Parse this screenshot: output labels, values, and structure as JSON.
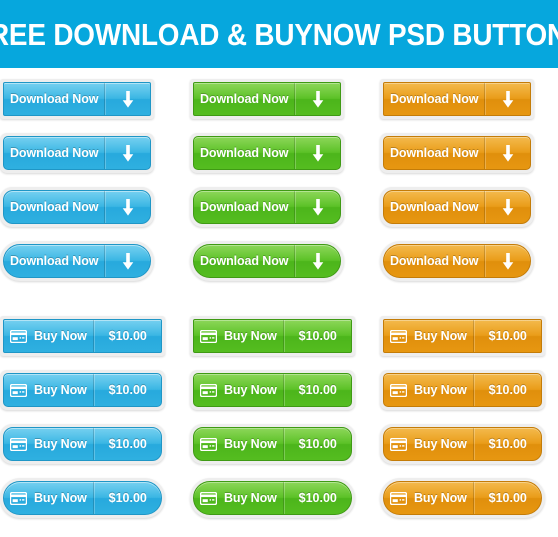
{
  "header": {
    "title": "FREE DOWNLOAD & BUYNOW PSD BUTTONS",
    "background_color": "#06a7dd",
    "text_color": "#ffffff"
  },
  "theme_colors": {
    "blue": "#29abe2",
    "green": "#52bf1e",
    "orange": "#e89a12",
    "frame": "#eeeeee",
    "page_background": "#ffffff"
  },
  "sections": [
    {
      "id": "download-buttons",
      "columns": [
        {
          "id": "download-blue",
          "theme": "blue",
          "color": "#29abe2"
        },
        {
          "id": "download-green",
          "theme": "green",
          "color": "#52bf1e"
        },
        {
          "id": "download-orange",
          "theme": "orange",
          "color": "#e89a12"
        }
      ],
      "rows": [
        {
          "corner_style": "square",
          "radius": 3
        },
        {
          "corner_style": "slight-round",
          "radius": 7
        },
        {
          "corner_style": "rounded",
          "radius": 12
        },
        {
          "corner_style": "pill",
          "radius": 22
        }
      ],
      "button": {
        "label": "Download Now",
        "icon": "download-arrow-icon"
      }
    },
    {
      "id": "buy-now-buttons",
      "columns": [
        {
          "id": "buy-blue",
          "theme": "blue",
          "color": "#29abe2"
        },
        {
          "id": "buy-green",
          "theme": "green",
          "color": "#52bf1e"
        },
        {
          "id": "buy-orange",
          "theme": "orange",
          "color": "#e89a12"
        }
      ],
      "rows": [
        {
          "corner_style": "square",
          "radius": 3
        },
        {
          "corner_style": "slight-round",
          "radius": 7
        },
        {
          "corner_style": "rounded",
          "radius": 12
        },
        {
          "corner_style": "pill",
          "radius": 22
        }
      ],
      "button": {
        "label": "Buy Now",
        "price": "$10.00",
        "icon": "credit-card-icon"
      }
    }
  ]
}
